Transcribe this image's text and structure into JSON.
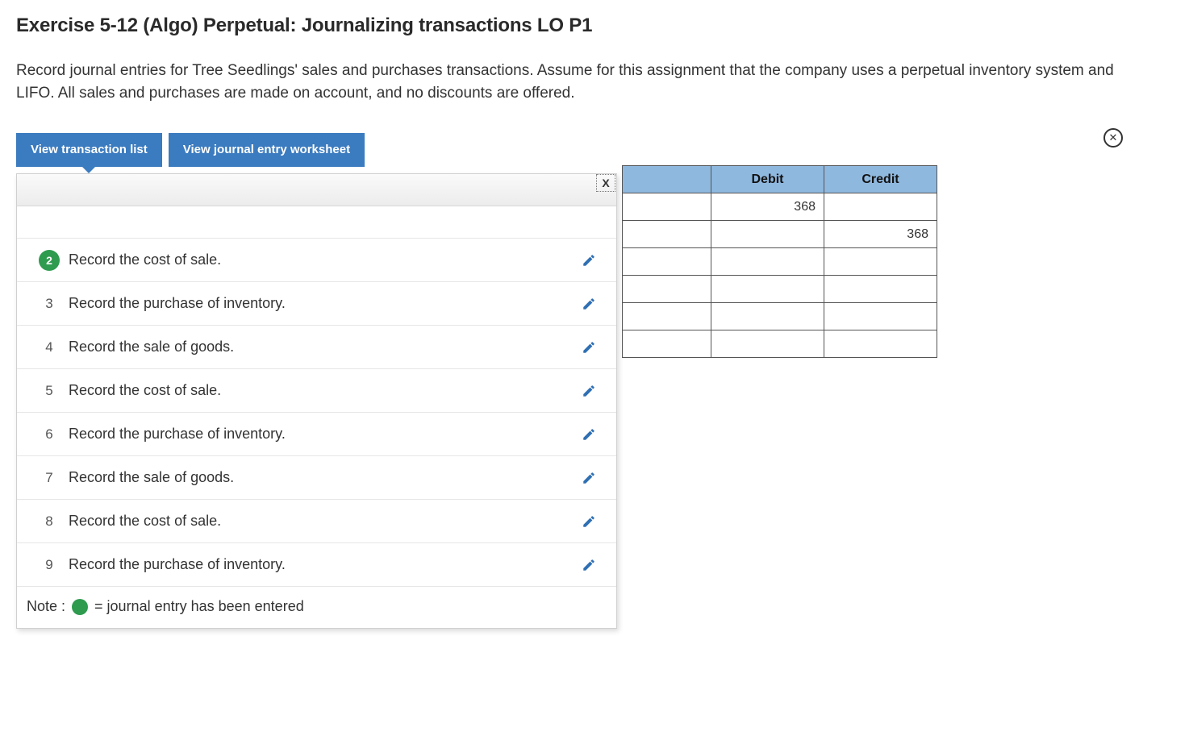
{
  "title": "Exercise 5-12 (Algo) Perpetual: Journalizing transactions LO P1",
  "instructions": "Record journal entries for Tree Seedlings' sales and purchases transactions. Assume for this assignment that the company uses a perpetual inventory system and LIFO. All sales and purchases are made on account, and no discounts are offered.",
  "tabs": {
    "transaction_list": "View transaction list",
    "journal_worksheet": "View journal entry worksheet"
  },
  "transactions": [
    {
      "num": "2",
      "label": "Record the cost of sale.",
      "entered": true
    },
    {
      "num": "3",
      "label": "Record the purchase of inventory.",
      "entered": false
    },
    {
      "num": "4",
      "label": "Record the sale of goods.",
      "entered": false
    },
    {
      "num": "5",
      "label": "Record the cost of sale.",
      "entered": false
    },
    {
      "num": "6",
      "label": "Record the purchase of inventory.",
      "entered": false
    },
    {
      "num": "7",
      "label": "Record the sale of goods.",
      "entered": false
    },
    {
      "num": "8",
      "label": "Record the cost of sale.",
      "entered": false
    },
    {
      "num": "9",
      "label": "Record the purchase of inventory.",
      "entered": false
    }
  ],
  "note": {
    "prefix": "Note :",
    "text": "= journal entry has been entered"
  },
  "entry_table": {
    "headers": {
      "debit": "Debit",
      "credit": "Credit"
    },
    "rows": [
      {
        "debit": "368",
        "credit": ""
      },
      {
        "debit": "",
        "credit": "368"
      },
      {
        "debit": "",
        "credit": ""
      },
      {
        "debit": "",
        "credit": ""
      },
      {
        "debit": "",
        "credit": ""
      },
      {
        "debit": "",
        "credit": ""
      }
    ]
  },
  "icons": {
    "x_marker": "X",
    "close": "✕"
  }
}
